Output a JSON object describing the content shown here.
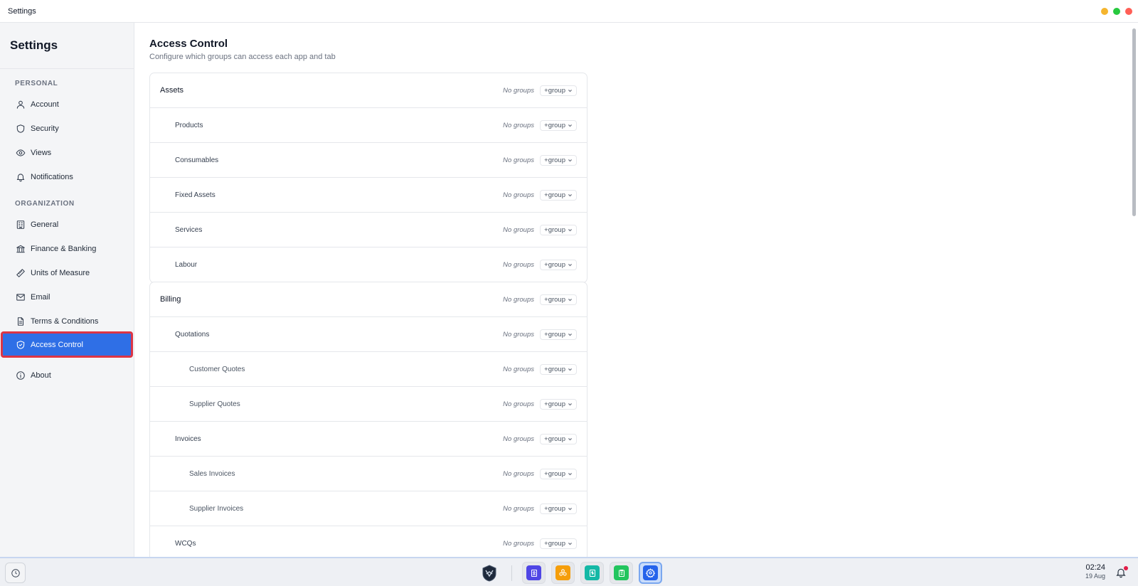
{
  "window": {
    "title": "Settings",
    "controls": {
      "minimize_color": "#f5b52e",
      "maximize_color": "#27c93f",
      "close_color": "#ff5f56"
    }
  },
  "sidebar": {
    "title": "Settings",
    "sections": [
      {
        "label": "PERSONAL",
        "items": [
          {
            "label": "Account",
            "icon": "user-icon"
          },
          {
            "label": "Security",
            "icon": "shield-icon"
          },
          {
            "label": "Views",
            "icon": "eye-icon"
          },
          {
            "label": "Notifications",
            "icon": "bell-icon"
          }
        ]
      },
      {
        "label": "ORGANIZATION",
        "items": [
          {
            "label": "General",
            "icon": "building-icon"
          },
          {
            "label": "Finance & Banking",
            "icon": "bank-icon"
          },
          {
            "label": "Units of Measure",
            "icon": "ruler-icon"
          },
          {
            "label": "Email",
            "icon": "mail-icon"
          },
          {
            "label": "Terms & Conditions",
            "icon": "document-icon"
          },
          {
            "label": "Access Control",
            "icon": "shield-check-icon",
            "active": true
          }
        ]
      }
    ],
    "about": {
      "label": "About",
      "icon": "info-icon"
    }
  },
  "main": {
    "title": "Access Control",
    "subtitle": "Configure which groups can access each app and tab",
    "no_groups_label": "No groups",
    "add_group_label": "+group",
    "cards": [
      {
        "rows": [
          {
            "name": "Assets",
            "level": 0
          },
          {
            "name": "Products",
            "level": 1
          },
          {
            "name": "Consumables",
            "level": 1
          },
          {
            "name": "Fixed Assets",
            "level": 1
          },
          {
            "name": "Services",
            "level": 1
          },
          {
            "name": "Labour",
            "level": 1
          }
        ]
      },
      {
        "rows": [
          {
            "name": "Billing",
            "level": 0
          },
          {
            "name": "Quotations",
            "level": 1
          },
          {
            "name": "Customer Quotes",
            "level": 2
          },
          {
            "name": "Supplier Quotes",
            "level": 2
          },
          {
            "name": "Invoices",
            "level": 1
          },
          {
            "name": "Sales Invoices",
            "level": 2
          },
          {
            "name": "Supplier Invoices",
            "level": 2
          },
          {
            "name": "WCQs",
            "level": 1
          }
        ]
      }
    ]
  },
  "taskbar": {
    "time": "02:24",
    "date": "19 Aug",
    "dock_apps": [
      {
        "name": "contacts-app",
        "icon": "contact-book-icon",
        "color": "#4f46e5"
      },
      {
        "name": "assets-app",
        "icon": "cubes-icon",
        "color": "#f59e0b"
      },
      {
        "name": "billing-app",
        "icon": "dollar-doc-icon",
        "color": "#14b8a6"
      },
      {
        "name": "clipboard-app",
        "icon": "clipboard-icon",
        "color": "#22c55e"
      },
      {
        "name": "settings-app",
        "icon": "gear-icon",
        "color": "#2563eb",
        "active": true
      }
    ]
  }
}
